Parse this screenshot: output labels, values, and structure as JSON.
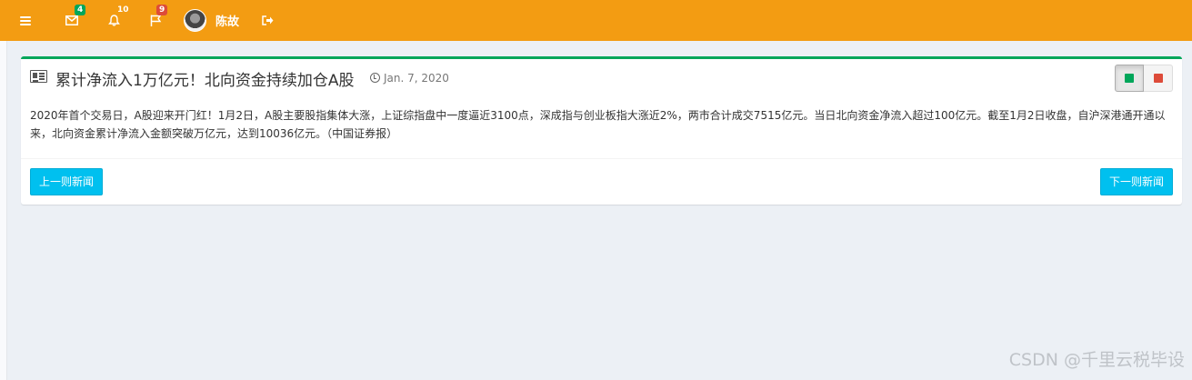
{
  "navbar": {
    "bg_color": "#f39c12",
    "messages_badge": "4",
    "notifications_badge": "10",
    "tasks_badge": "9",
    "user_name": "陈故"
  },
  "news": {
    "title": "累计净流入1万亿元！北向资金持续加仓A股",
    "date": "Jan. 7, 2020",
    "body": "2020年首个交易日，A股迎来开门红！1月2日，A股主要股指集体大涨，上证综指盘中一度逼近3100点，深成指与创业板指大涨近2%，两市合计成交7515亿元。当日北向资金净流入超过100亿元。截至1月2日收盘，自沪深港通开通以来，北向资金累计净流入金额突破万亿元，达到10036亿元。（中国证券报）",
    "prev_label": "上一则新闻",
    "next_label": "下一则新闻",
    "accent_color": "#00a65a"
  },
  "watermark": "CSDN @千里云税毕设"
}
